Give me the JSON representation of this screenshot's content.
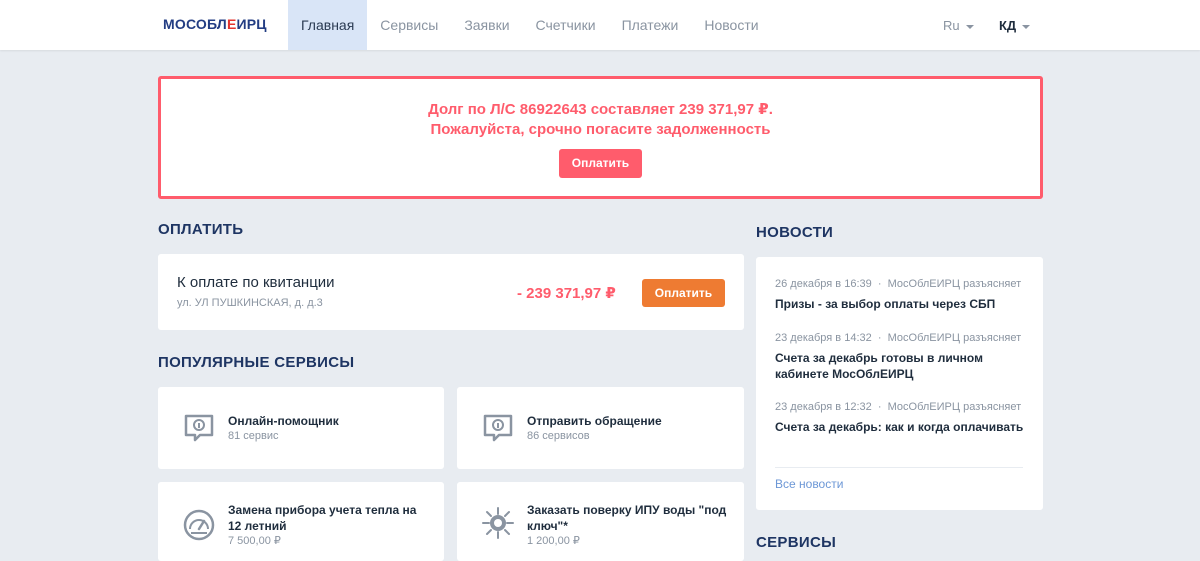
{
  "header": {
    "logo": {
      "part1": "МОСОБЛ",
      "part2": "Е",
      "part3": "ИРЦ"
    },
    "nav": [
      {
        "label": "Главная",
        "active": true
      },
      {
        "label": "Сервисы",
        "active": false
      },
      {
        "label": "Заявки",
        "active": false
      },
      {
        "label": "Счетчики",
        "active": false
      },
      {
        "label": "Платежи",
        "active": false
      },
      {
        "label": "Новости",
        "active": false
      }
    ],
    "language": "Ru",
    "user_initials": "КД"
  },
  "alert": {
    "line1": "Долг по Л/С 86922643 составляет 239 371,97 ₽.",
    "line2": "Пожалуйста, срочно погасите задолженность",
    "button": "Оплатить"
  },
  "pay": {
    "section_title": "ОПЛАТИТЬ",
    "title": "К оплате по квитанции",
    "address": "ул. УЛ ПУШКИНСКАЯ, д. д.3",
    "amount": "- 239 371,97 ₽",
    "button": "Оплатить"
  },
  "services": {
    "section_title": "ПОПУЛЯРНЫЕ СЕРВИСЫ",
    "items": [
      {
        "name": "Онлайн-помощник",
        "sub": "81 сервис",
        "icon": "chat-icon"
      },
      {
        "name": "Отправить обращение",
        "sub": "86 сервисов",
        "icon": "chat-icon"
      },
      {
        "name": "Замена прибора учета тепла на 12 летний",
        "sub": "7 500,00 ₽",
        "icon": "gauge-icon"
      },
      {
        "name": "Заказать поверку ИПУ воды \"под ключ\"*",
        "sub": "1 200,00 ₽",
        "icon": "sun-badge-icon"
      }
    ]
  },
  "news": {
    "section_title": "НОВОСТИ",
    "items": [
      {
        "date": "26 декабря в 16:39",
        "source": "МосОблЕИРЦ разъясняет",
        "title": "Призы - за выбор оплаты через СБП"
      },
      {
        "date": "23 декабря в 14:32",
        "source": "МосОблЕИРЦ разъясняет",
        "title": "Счета за декабрь готовы в личном кабинете МосОблЕИРЦ"
      },
      {
        "date": "23 декабря в 12:32",
        "source": "МосОблЕИРЦ разъясняет",
        "title": "Счета за декабрь: как и когда оплачивать"
      }
    ],
    "all_link": "Все новости"
  },
  "services_right": {
    "section_title": "СЕРВИСЫ"
  },
  "colors": {
    "accent_red": "#ff5c6c",
    "accent_orange": "#ee7b32",
    "brand_blue": "#233d83",
    "nav_active_bg": "#d9e5f7"
  }
}
